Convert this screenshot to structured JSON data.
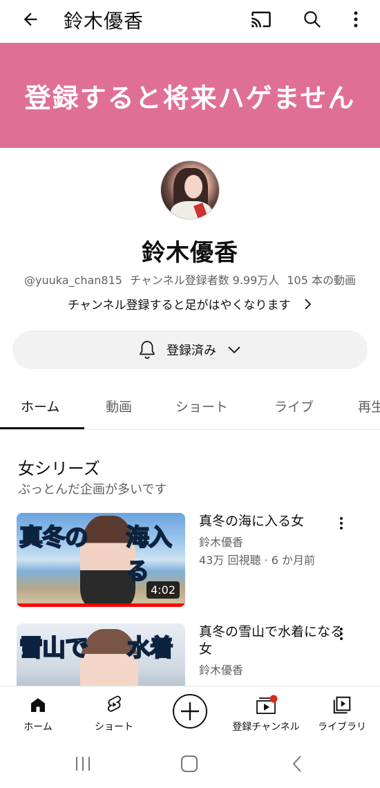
{
  "appbar": {
    "title": "鈴木優香",
    "icons": [
      "back-arrow-icon",
      "cast-icon",
      "search-icon",
      "more-vert-icon"
    ]
  },
  "banner": {
    "text": "登録すると将来ハゲません",
    "color": "#e06f96"
  },
  "channel": {
    "name": "鈴木優香",
    "handle": "@yuuka_chan815",
    "subscribers": "チャンネル登録者数 9.99万人",
    "video_count": "105 本の動画",
    "tagline": "チャンネル登録すると足がはやくなります",
    "subscribe_state": "登録済み"
  },
  "tabs": [
    "ホーム",
    "動画",
    "ショート",
    "ライブ",
    "再生"
  ],
  "section": {
    "title": "女シリーズ",
    "subtitle": "ぶっとんだ企画が多いです"
  },
  "videos": [
    {
      "title": "真冬の海に入る女",
      "channel": "鈴木優香",
      "stats": "43万 回視聴 · 6 か月前",
      "duration": "4:02",
      "thumb_text_left": "真冬の",
      "thumb_text_right": "海入る",
      "progress": 1.0
    },
    {
      "title": "真冬の雪山で水着になる女",
      "channel": "鈴木優香",
      "stats": "",
      "thumb_text_left": "雪山で",
      "thumb_text_right": "水着"
    }
  ],
  "bottom_nav": [
    {
      "label": "ホーム",
      "icon": "home-icon"
    },
    {
      "label": "ショート",
      "icon": "shorts-icon"
    },
    {
      "label": "",
      "icon": "create-plus-icon"
    },
    {
      "label": "登録チャンネル",
      "icon": "subscriptions-icon"
    },
    {
      "label": "ライブラリ",
      "icon": "library-icon"
    }
  ],
  "colors": {
    "accent_red": "#ff0000",
    "text_primary": "#0f0f0f",
    "text_secondary": "#606060"
  }
}
